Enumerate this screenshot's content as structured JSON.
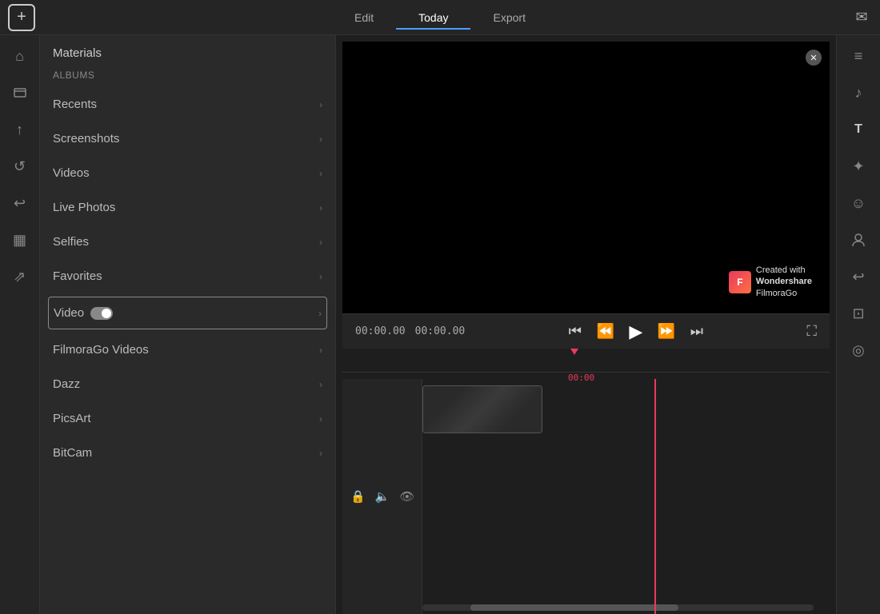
{
  "topbar": {
    "edit_label": "Edit",
    "export_label": "Export",
    "today_label": "Today",
    "mail_icon": "✉"
  },
  "icon_sidebar": {
    "icons": [
      {
        "name": "home-icon",
        "symbol": "⌂",
        "active": false
      },
      {
        "name": "layers-icon",
        "symbol": "▭",
        "active": false
      },
      {
        "name": "share-icon",
        "symbol": "↑",
        "active": false
      },
      {
        "name": "rotate-icon",
        "symbol": "↺",
        "active": false
      },
      {
        "name": "undo-icon",
        "symbol": "↩",
        "active": false
      },
      {
        "name": "grid-icon",
        "symbol": "▦",
        "active": false
      },
      {
        "name": "share2-icon",
        "symbol": "⇗",
        "active": false
      }
    ]
  },
  "left_panel": {
    "materials_label": "Materials",
    "albums_label": "Albums",
    "menu_items": [
      {
        "label": "Recents",
        "has_chevron": true
      },
      {
        "label": "Screenshots",
        "has_chevron": true
      },
      {
        "label": "Videos",
        "has_chevron": true
      },
      {
        "label": "Live Photos",
        "has_chevron": true
      },
      {
        "label": "Selfies",
        "has_chevron": true
      },
      {
        "label": "Favorites",
        "has_chevron": true
      },
      {
        "label": "Video",
        "has_chevron": true,
        "has_toggle": true,
        "is_boxed": true
      },
      {
        "label": "FilmoraGo Videos",
        "has_chevron": true
      },
      {
        "label": "Dazz",
        "has_chevron": true
      },
      {
        "label": "PicsArt",
        "has_chevron": true
      },
      {
        "label": "BitCam",
        "has_chevron": true
      }
    ]
  },
  "preview": {
    "watermark_text_line1": "Created with",
    "watermark_text_line2": "Wondershare",
    "watermark_text_line3": "FilmoraGo",
    "close_symbol": "✕"
  },
  "playback": {
    "time_current": "00:00.00",
    "time_total": "00:00.00",
    "btn_skip_back": "⏮",
    "btn_back": "⏪",
    "btn_play": "▶",
    "btn_forward": "⏩",
    "btn_skip_forward": "⏭",
    "btn_fullscreen": "⛶"
  },
  "timeline": {
    "marker_time": "00:00",
    "lock_icon": "🔒",
    "sound_icon": "🔈",
    "eye_icon": "👁"
  },
  "right_sidebar": {
    "icons": [
      {
        "name": "menu-icon",
        "symbol": "≡"
      },
      {
        "name": "music-icon",
        "symbol": "♪"
      },
      {
        "name": "text-icon",
        "symbol": "T"
      },
      {
        "name": "sticker-icon",
        "symbol": "✦"
      },
      {
        "name": "emoji-icon",
        "symbol": "☺"
      },
      {
        "name": "person-icon",
        "symbol": "◯"
      },
      {
        "name": "back-icon",
        "symbol": "↩"
      },
      {
        "name": "crop-icon",
        "symbol": "⊡"
      },
      {
        "name": "headphone-icon",
        "symbol": "◎"
      }
    ]
  }
}
